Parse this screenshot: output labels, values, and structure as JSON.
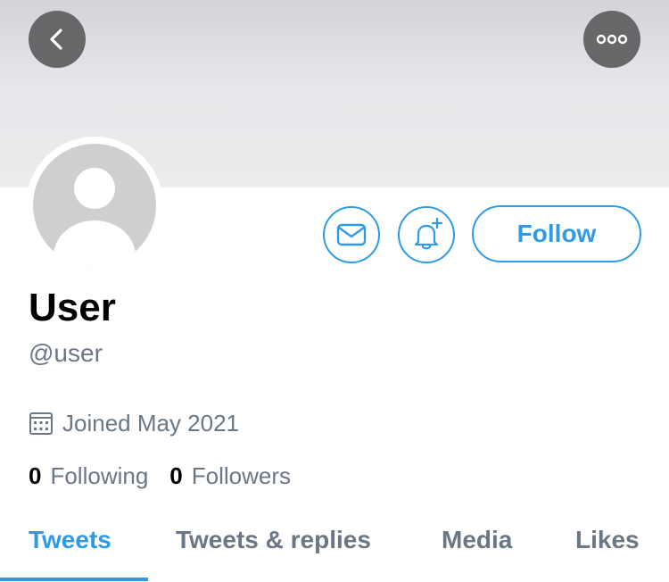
{
  "header": {
    "back_icon": "chevron-left-icon",
    "more_icon": "more-horizontal-icon"
  },
  "profile": {
    "display_name": "User",
    "handle": "@user",
    "joined": "Joined May 2021",
    "following_count": "0",
    "following_label": "Following",
    "followers_count": "0",
    "followers_label": "Followers"
  },
  "actions": {
    "message_icon": "envelope-icon",
    "notify_icon": "bell-plus-icon",
    "follow_label": "Follow"
  },
  "tabs": [
    {
      "label": "Tweets",
      "active": true
    },
    {
      "label": "Tweets & replies",
      "active": false
    },
    {
      "label": "Media",
      "active": false
    },
    {
      "label": "Likes",
      "active": false
    }
  ],
  "colors": {
    "accent": "#2f9ae5",
    "secondary_text": "#6b7784",
    "banner": "#e6e7ea"
  }
}
